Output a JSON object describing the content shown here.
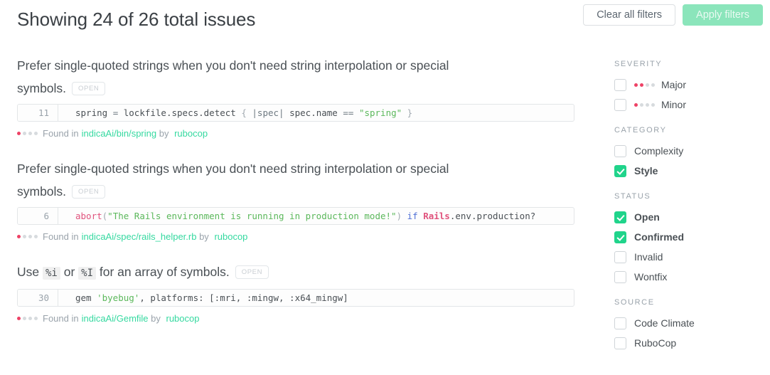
{
  "header": {
    "title": "Showing 24 of 26 total issues",
    "clear_label": "Clear all filters",
    "apply_label": "Apply filters"
  },
  "issues": [
    {
      "title_before": "Prefer single-quoted strings when you don't need string interpolation or special symbols.",
      "status_badge": "OPEN",
      "line_number": "11",
      "code_tokens": [
        {
          "t": "spring ",
          "c": "tok-plain"
        },
        {
          "t": "= ",
          "c": "tok-op"
        },
        {
          "t": "lockfile",
          "c": "tok-plain"
        },
        {
          "t": ".specs",
          "c": "tok-plain"
        },
        {
          "t": ".detect ",
          "c": "tok-plain"
        },
        {
          "t": "{ ",
          "c": "tok-punc"
        },
        {
          "t": "|spec| ",
          "c": "tok-op"
        },
        {
          "t": "spec",
          "c": "tok-plain"
        },
        {
          "t": ".name ",
          "c": "tok-plain"
        },
        {
          "t": "== ",
          "c": "tok-op"
        },
        {
          "t": "\"spring\" ",
          "c": "tok-str"
        },
        {
          "t": "}",
          "c": "tok-punc"
        }
      ],
      "severity_dots": 1,
      "found_prefix": "Found in",
      "file_path": "indicaAi/bin/spring",
      "by_text": "by",
      "engine": "rubocop"
    },
    {
      "title_before": "Prefer single-quoted strings when you don't need string interpolation or special symbols.",
      "status_badge": "OPEN",
      "line_number": "6",
      "code_tokens": [
        {
          "t": "abort",
          "c": "tok-fn"
        },
        {
          "t": "(",
          "c": "tok-punc"
        },
        {
          "t": "\"The Rails environment is running in production mode!\"",
          "c": "tok-str"
        },
        {
          "t": ") ",
          "c": "tok-punc"
        },
        {
          "t": "if ",
          "c": "tok-kw"
        },
        {
          "t": "Rails",
          "c": "tok-const"
        },
        {
          "t": ".env",
          "c": "tok-plain"
        },
        {
          "t": ".production?",
          "c": "tok-plain"
        }
      ],
      "severity_dots": 1,
      "found_prefix": "Found in",
      "file_path": "indicaAi/spec/rails_helper.rb",
      "by_text": "by",
      "engine": "rubocop"
    },
    {
      "title_before": "Use ",
      "title_code_1": "%i",
      "title_mid": " or ",
      "title_code_2": "%I",
      "title_after": " for an array of symbols.",
      "status_badge": "OPEN",
      "line_number": "30",
      "code_tokens": [
        {
          "t": "gem ",
          "c": "tok-plain"
        },
        {
          "t": "'byebug'",
          "c": "tok-str"
        },
        {
          "t": ", platforms: [:mri, :mingw, :x64_mingw]",
          "c": "tok-plain"
        }
      ],
      "severity_dots": 1,
      "found_prefix": "Found in",
      "file_path": "indicaAi/Gemfile",
      "by_text": "by",
      "engine": "rubocop"
    }
  ],
  "sidebar": {
    "groups": [
      {
        "heading": "SEVERITY",
        "items": [
          {
            "label": "Major",
            "checked": false,
            "dots": 2
          },
          {
            "label": "Minor",
            "checked": false,
            "dots": 1
          }
        ]
      },
      {
        "heading": "CATEGORY",
        "items": [
          {
            "label": "Complexity",
            "checked": false
          },
          {
            "label": "Style",
            "checked": true
          }
        ]
      },
      {
        "heading": "STATUS",
        "items": [
          {
            "label": "Open",
            "checked": true
          },
          {
            "label": "Confirmed",
            "checked": true
          },
          {
            "label": "Invalid",
            "checked": false
          },
          {
            "label": "Wontfix",
            "checked": false
          }
        ]
      },
      {
        "heading": "SOURCE",
        "items": [
          {
            "label": "Code Climate",
            "checked": false
          },
          {
            "label": "RuboCop",
            "checked": false
          }
        ]
      }
    ]
  },
  "colors": {
    "accent_green": "#20d48b",
    "link_green": "#35d9a0",
    "apply_button": "#8be5bb",
    "severity_red": "#ee4266",
    "dot_gray": "#d7dbde",
    "text": "#4a5055",
    "muted": "#9aa3ab"
  }
}
